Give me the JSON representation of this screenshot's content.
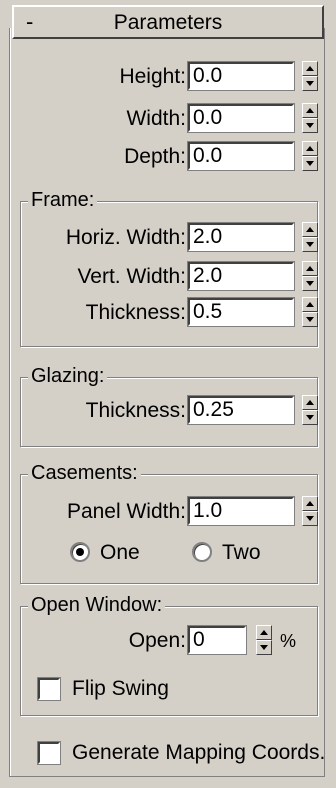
{
  "rollout": {
    "collapse_symbol": "-",
    "title": "Parameters"
  },
  "dimensions": {
    "height_label": "Height:",
    "height_value": "0.0",
    "width_label": "Width:",
    "width_value": "0.0",
    "depth_label": "Depth:",
    "depth_value": "0.0"
  },
  "frame": {
    "title": "Frame:",
    "horiz_width_label": "Horiz. Width:",
    "horiz_width_value": "2.0",
    "vert_width_label": "Vert. Width:",
    "vert_width_value": "2.0",
    "thickness_label": "Thickness:",
    "thickness_value": "0.5"
  },
  "glazing": {
    "title": "Glazing:",
    "thickness_label": "Thickness:",
    "thickness_value": "0.25"
  },
  "casements": {
    "title": "Casements:",
    "panel_width_label": "Panel Width:",
    "panel_width_value": "1.0",
    "options": [
      {
        "label": "One",
        "selected": true
      },
      {
        "label": "Two",
        "selected": false
      }
    ]
  },
  "open_window": {
    "title": "Open Window:",
    "open_label": "Open:",
    "open_value": "0",
    "open_unit": "%",
    "flip_swing_label": "Flip Swing",
    "flip_swing_checked": false
  },
  "generate_mapping": {
    "label": "Generate Mapping Coords.",
    "checked": false
  },
  "colors": {
    "panel_bg": "#d4d0c8",
    "field_bg": "#ffffff"
  }
}
